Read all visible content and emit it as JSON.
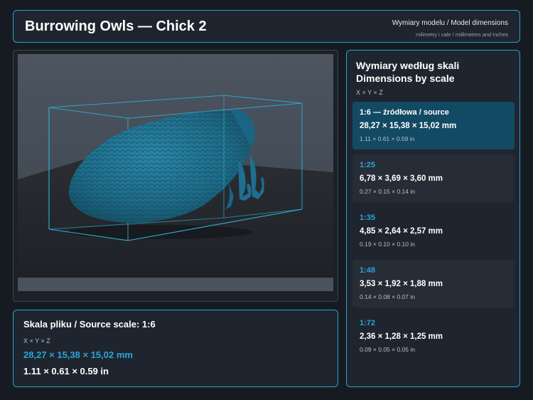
{
  "header": {
    "title": "Burrowing Owls — Chick 2",
    "subtitle": "Wymiary modelu / Model dimensions",
    "units_note": "milimetry i cale / millimetres and inches"
  },
  "source": {
    "title": "Skala pliku / Source scale: 1:6",
    "axis": "X × Y × Z",
    "mm": "28,27 × 15,38 × 15,02 mm",
    "inches": "1.11 × 0.61 × 0.59 in"
  },
  "scales": {
    "title": "Wymiary według skali Dimensions by scale",
    "axis": "X × Y × Z",
    "items": [
      {
        "ratio": "1:6  —  źródłowa / source",
        "mm": "28,27 × 15,38 × 15,02 mm",
        "inches": "1.11 × 0.61 × 0.59 in",
        "active": true
      },
      {
        "ratio": "1:25",
        "mm": "6,78 × 3,69 × 3,60 mm",
        "inches": "0.27 × 0.15 × 0.14 in",
        "active": false
      },
      {
        "ratio": "1:35",
        "mm": "4,85 × 2,64 × 2,57 mm",
        "inches": "0.19 × 0.10 × 0.10 in",
        "active": false
      },
      {
        "ratio": "1:48",
        "mm": "3,53 × 1,92 × 1,88 mm",
        "inches": "0.14 × 0.08 × 0.07 in",
        "active": false
      },
      {
        "ratio": "1:72",
        "mm": "2,36 × 1,28 × 1,25 mm",
        "inches": "0.09 × 0.05 × 0.05 in",
        "active": false
      }
    ]
  },
  "colors": {
    "accent": "#2aa4da",
    "active_card": "#134a63",
    "model": "#1f6f8f"
  }
}
